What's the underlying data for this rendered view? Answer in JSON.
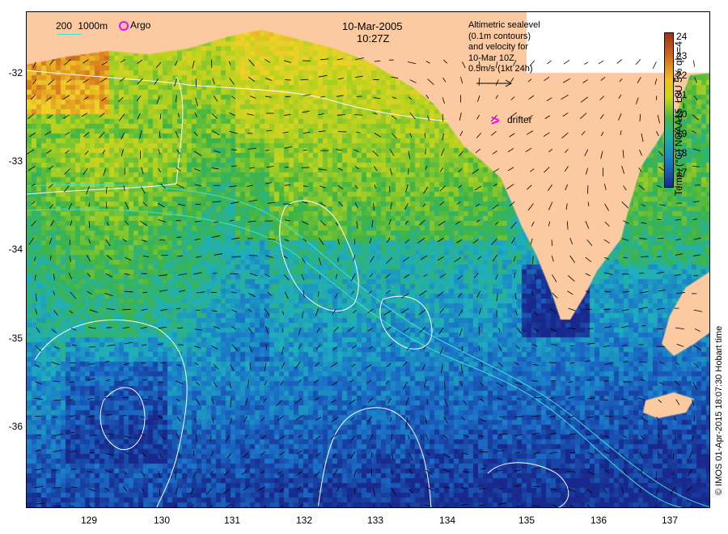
{
  "map": {
    "date": "10-Mar-2005",
    "time": "10:27Z",
    "legend_scale": {
      "depth_a": "200",
      "depth_b": "1000m"
    },
    "argo_label": "Argo",
    "drifter_label": "drifter",
    "altimetry_lines": [
      "Altimetric sealevel",
      "(0.1m contours)",
      "and velocity for",
      "10-Mar 10Z"
    ],
    "velocity_scale": "0.5m/s (1kt 24h)",
    "colorbar_title": "Temp. (°C) NOAA15_L3U 5% ql>=4",
    "colorbar_ticks": [
      "24",
      "23",
      "22",
      "21",
      "20",
      "19",
      "18",
      "17"
    ],
    "credit": "© IMOS 01-Apr-2015 18:07:30 Hobart time",
    "lat_ticks": [
      "-32",
      "-33",
      "-34",
      "-35",
      "-36"
    ],
    "lon_ticks": [
      "129",
      "130",
      "131",
      "132",
      "133",
      "134",
      "135",
      "136",
      "137"
    ],
    "colors": {
      "land": "#fbcaa0",
      "argo": "#ff00ff",
      "drifter": "#ff00ff",
      "depth_contour": "#40e0d0"
    }
  }
}
